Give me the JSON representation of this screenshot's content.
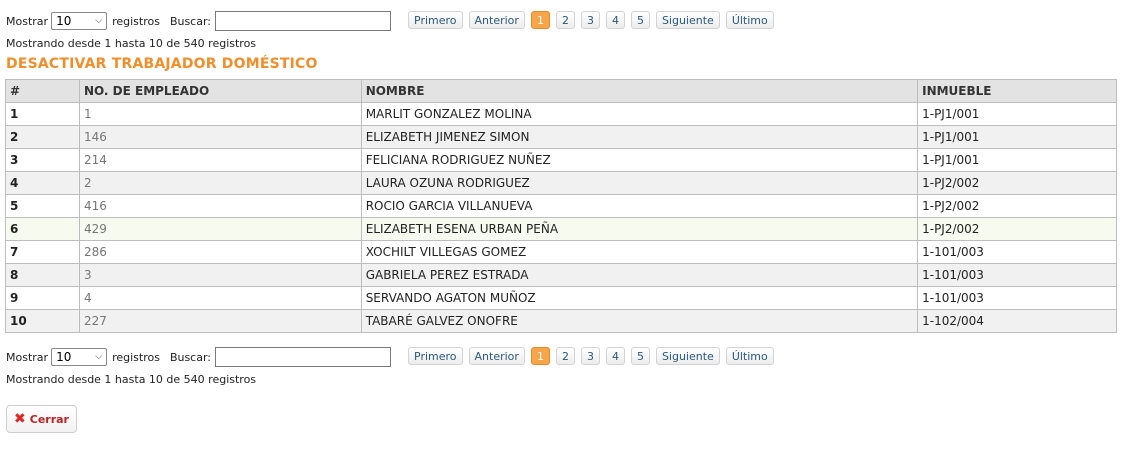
{
  "length_control": {
    "label_before": "Mostrar",
    "selected": "10",
    "label_after": "registros"
  },
  "search": {
    "label": "Buscar:",
    "value": ""
  },
  "pagination": {
    "first": "Primero",
    "previous": "Anterior",
    "pages": [
      "1",
      "2",
      "3",
      "4",
      "5"
    ],
    "next": "Siguiente",
    "last": "Último"
  },
  "info_text": "Mostrando desde 1 hasta 10 de 540 registros",
  "title": "DESACTIVAR TRABAJADOR DOMÉSTICO",
  "table": {
    "headers": [
      "#",
      "NO. DE EMPLEADO",
      "NOMBRE",
      "INMUEBLE"
    ],
    "rows": [
      [
        "1",
        "1",
        "MARLIT GONZALEZ MOLINA",
        "1-PJ1/001"
      ],
      [
        "2",
        "146",
        "ELIZABETH JIMENEZ SIMON",
        "1-PJ1/001"
      ],
      [
        "3",
        "214",
        "FELICIANA RODRIGUEZ NUÑEZ",
        "1-PJ1/001"
      ],
      [
        "4",
        "2",
        "LAURA OZUNA RODRIGUEZ",
        "1-PJ2/002"
      ],
      [
        "5",
        "416",
        "ROCIO GARCIA VILLANUEVA",
        "1-PJ2/002"
      ],
      [
        "6",
        "429",
        "ELIZABETH ESENA URBAN PEÑA",
        "1-PJ2/002"
      ],
      [
        "7",
        "286",
        "XOCHILT VILLEGAS GOMEZ",
        "1-101/003"
      ],
      [
        "8",
        "3",
        "GABRIELA PEREZ ESTRADA",
        "1-101/003"
      ],
      [
        "9",
        "4",
        "SERVANDO AGATON MUÑOZ",
        "1-101/003"
      ],
      [
        "10",
        "227",
        "TABARÉ GALVEZ ONOFRE",
        "1-102/004"
      ]
    ]
  },
  "close_button": {
    "label": "Cerrar",
    "icon": "close-icon"
  },
  "colors": {
    "accent": "#f28e29",
    "active_page": "#f7a44a",
    "close_icon": "#e32222"
  }
}
